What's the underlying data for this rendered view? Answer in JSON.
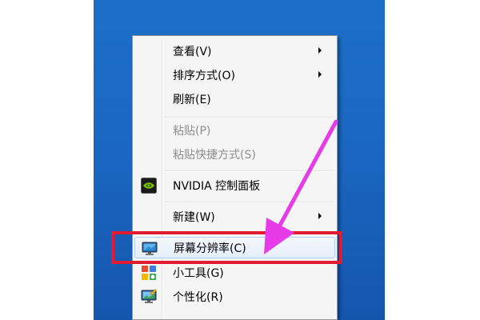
{
  "context_menu": {
    "items": [
      {
        "label": "查看(V)",
        "submenu": true
      },
      {
        "label": "排序方式(O)",
        "submenu": true
      },
      {
        "label": "刷新(E)"
      },
      {
        "label": "粘贴(P)",
        "disabled": true
      },
      {
        "label": "粘贴快捷方式(S)",
        "disabled": true
      },
      {
        "label": "NVIDIA 控制面板",
        "icon": "nvidia-icon"
      },
      {
        "label": "新建(W)",
        "submenu": true
      },
      {
        "label": "屏幕分辨率(C)",
        "icon": "monitor-icon",
        "highlighted": true
      },
      {
        "label": "小工具(G)",
        "icon": "gadgets-icon"
      },
      {
        "label": "个性化(R)",
        "icon": "personalize-icon"
      }
    ]
  },
  "colors": {
    "desktop": "#1a66c0",
    "annotation_red": "#e01b32",
    "annotation_magenta": "#e63be6"
  }
}
